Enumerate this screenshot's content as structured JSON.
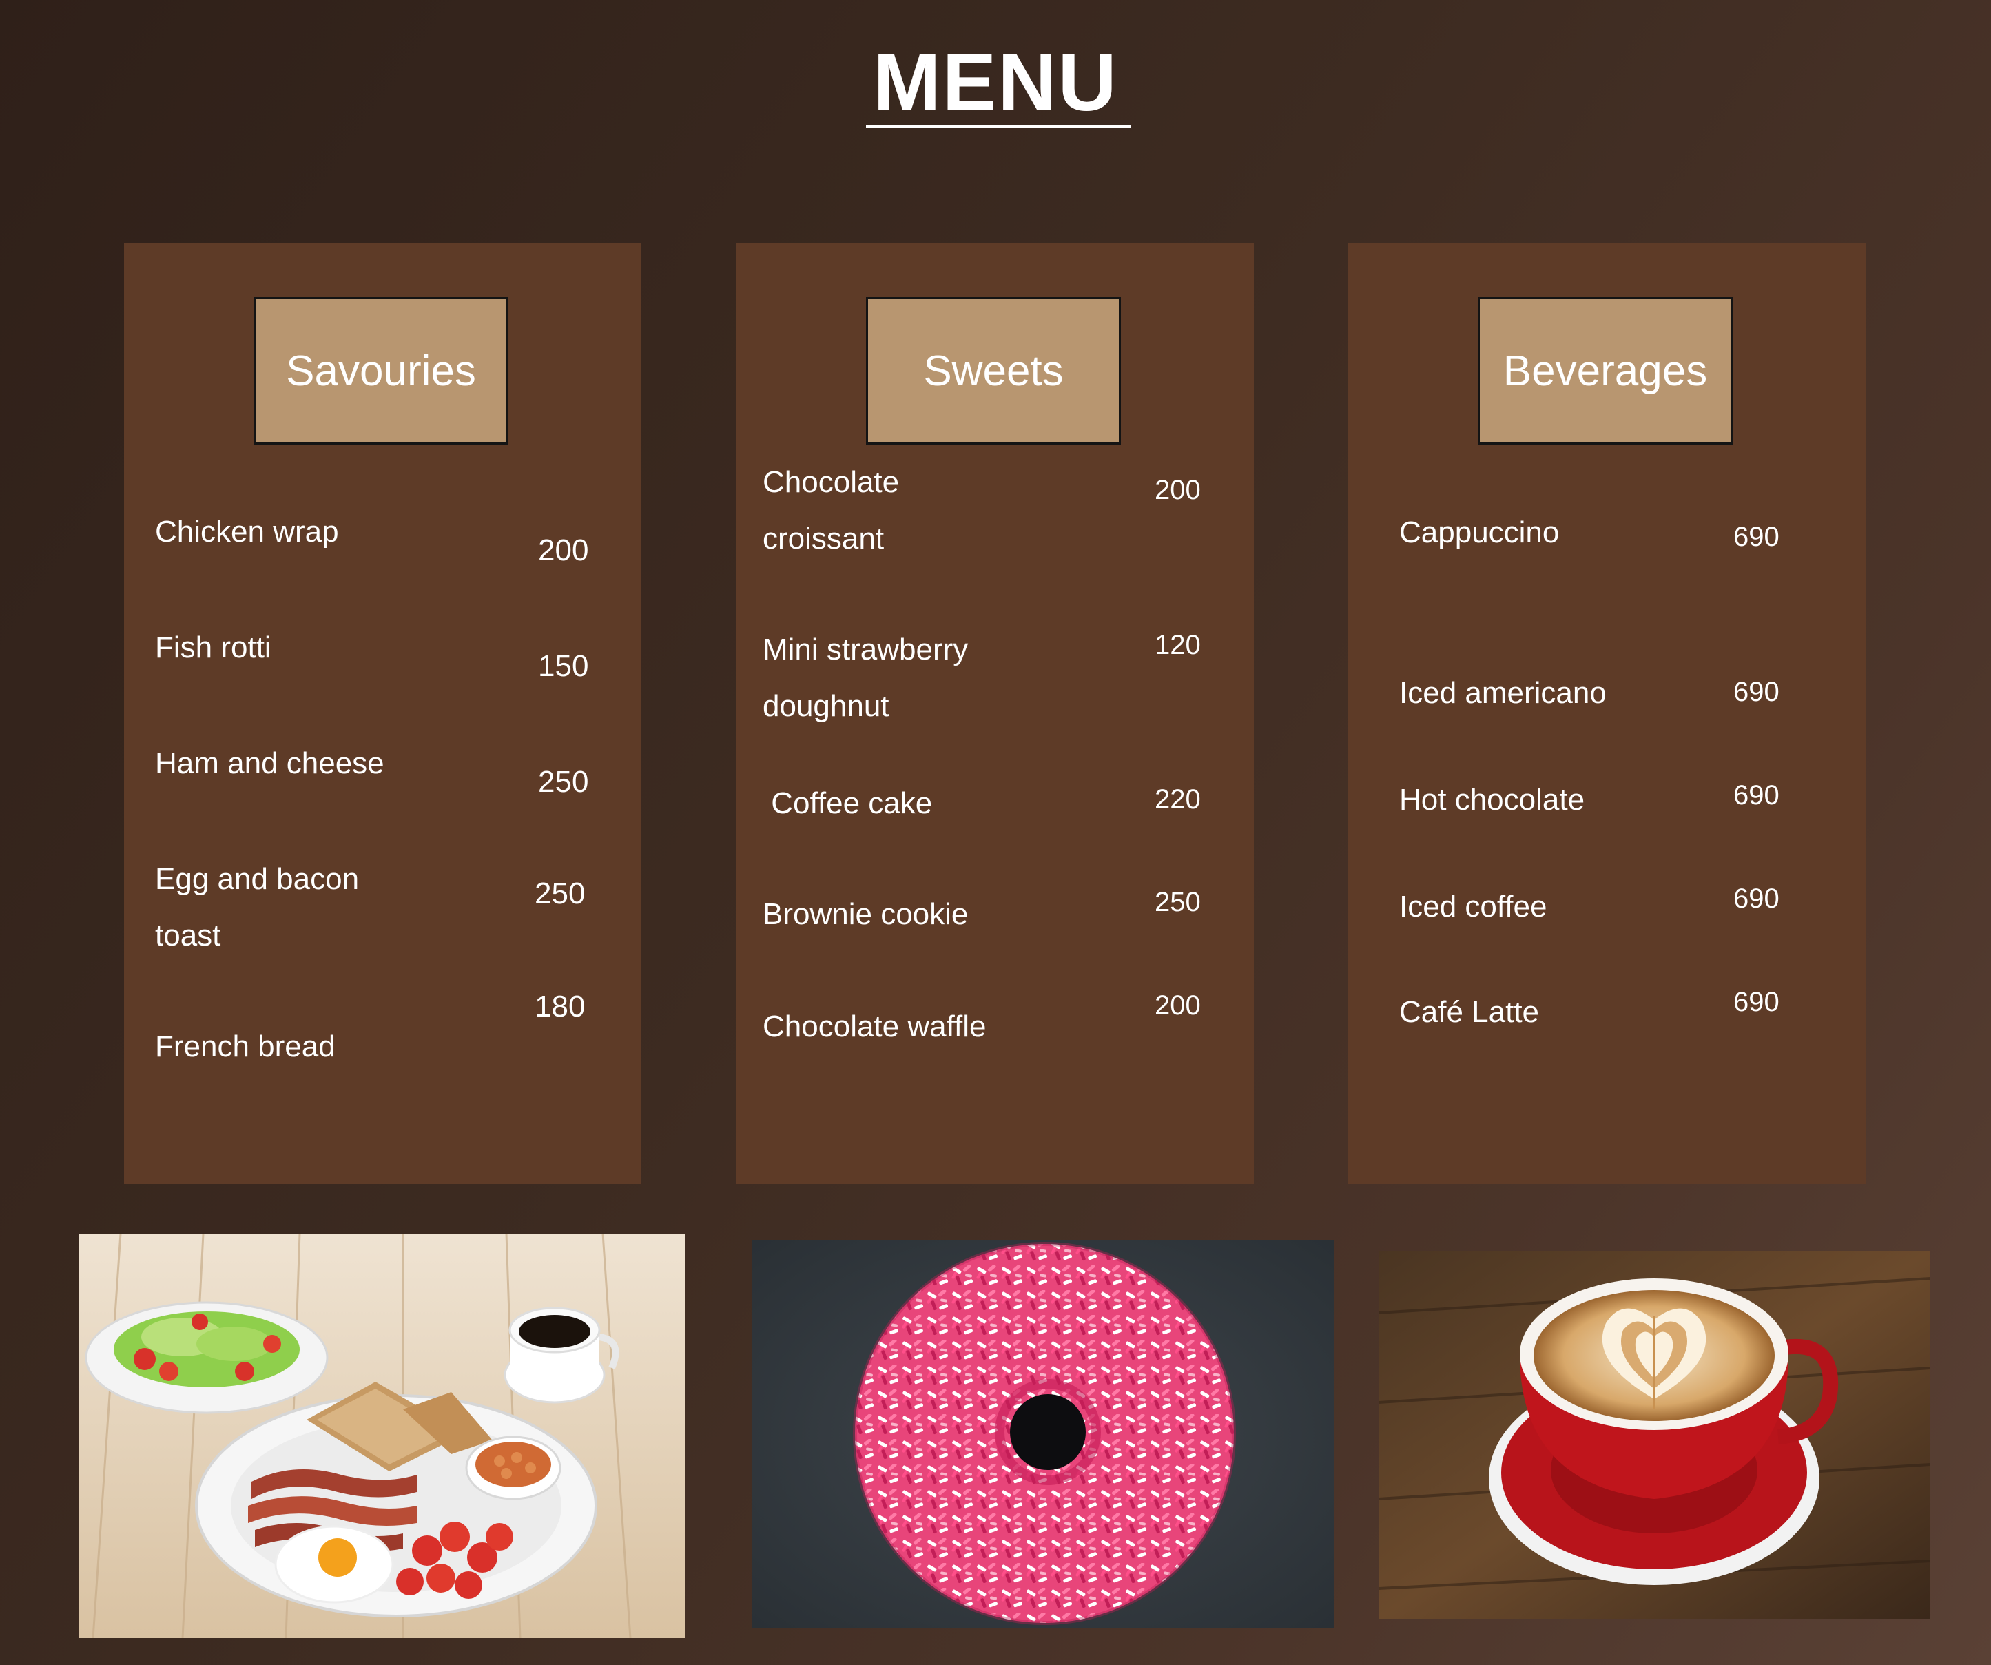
{
  "title": "MENU",
  "sections": [
    {
      "heading": "Savouries",
      "items": [
        {
          "name": "Chicken wrap",
          "price": "200"
        },
        {
          "name": "Fish rotti",
          "price": "150"
        },
        {
          "name": "Ham and cheese",
          "price": "250"
        },
        {
          "name": "Egg and bacon\ntoast",
          "price": "250"
        },
        {
          "name": "French bread",
          "price": "180"
        }
      ]
    },
    {
      "heading": "Sweets",
      "items": [
        {
          "name": "Chocolate\ncroissant",
          "price": "200"
        },
        {
          "name": "Mini strawberry\ndoughnut",
          "price": "120"
        },
        {
          "name": " Coffee cake",
          "price": "220"
        },
        {
          "name": "Brownie cookie",
          "price": "250"
        },
        {
          "name": "Chocolate waffle",
          "price": "200"
        }
      ]
    },
    {
      "heading": "Beverages",
      "items": [
        {
          "name": "Cappuccino",
          "price": "690"
        },
        {
          "name": "Iced americano",
          "price": "690"
        },
        {
          "name": "Hot chocolate",
          "price": "690"
        },
        {
          "name": "Iced coffee",
          "price": "690"
        },
        {
          "name": "Café Latte",
          "price": "690"
        }
      ]
    }
  ],
  "colors": {
    "card": "#5e3b27",
    "header_box": "#b89670",
    "text": "#ffffff"
  }
}
